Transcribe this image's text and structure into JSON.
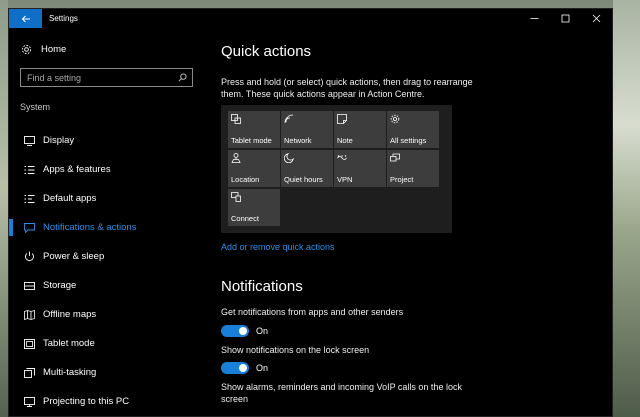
{
  "window": {
    "title": "Settings"
  },
  "sidebar": {
    "home_label": "Home",
    "search_placeholder": "Find a setting",
    "section": "System",
    "items": [
      {
        "label": "Display",
        "icon": "monitor-icon"
      },
      {
        "label": "Apps & features",
        "icon": "apps-list-icon"
      },
      {
        "label": "Default apps",
        "icon": "default-apps-icon"
      },
      {
        "label": "Notifications & actions",
        "icon": "notifications-icon",
        "active": true
      },
      {
        "label": "Power & sleep",
        "icon": "power-icon"
      },
      {
        "label": "Storage",
        "icon": "storage-icon"
      },
      {
        "label": "Offline maps",
        "icon": "map-icon"
      },
      {
        "label": "Tablet mode",
        "icon": "tablet-icon"
      },
      {
        "label": "Multi-tasking",
        "icon": "multitasking-icon"
      },
      {
        "label": "Projecting to this PC",
        "icon": "projecting-icon"
      }
    ]
  },
  "quick_actions": {
    "heading": "Quick actions",
    "description": "Press and hold (or select) quick actions, then drag to rearrange them. These quick actions appear in Action Centre.",
    "tiles": [
      {
        "label": "Tablet mode",
        "icon": "tablet-mode-icon"
      },
      {
        "label": "Network",
        "icon": "network-icon"
      },
      {
        "label": "Note",
        "icon": "note-icon"
      },
      {
        "label": "All settings",
        "icon": "gear-icon"
      },
      {
        "label": "Location",
        "icon": "location-icon"
      },
      {
        "label": "Quiet hours",
        "icon": "moon-icon"
      },
      {
        "label": "VPN",
        "icon": "vpn-icon"
      },
      {
        "label": "Project",
        "icon": "project-icon"
      },
      {
        "label": "Connect",
        "icon": "connect-icon"
      }
    ],
    "link": "Add or remove quick actions"
  },
  "notifications": {
    "heading": "Notifications",
    "settings": [
      {
        "label": "Get notifications from apps and other senders",
        "state": "On"
      },
      {
        "label": "Show notifications on the lock screen",
        "state": "On"
      },
      {
        "label": "Show alarms, reminders and incoming VoIP calls on the lock screen"
      }
    ]
  },
  "colors": {
    "accent": "#1a7fd9",
    "background": "#000000",
    "tile": "#3d3d3d"
  }
}
